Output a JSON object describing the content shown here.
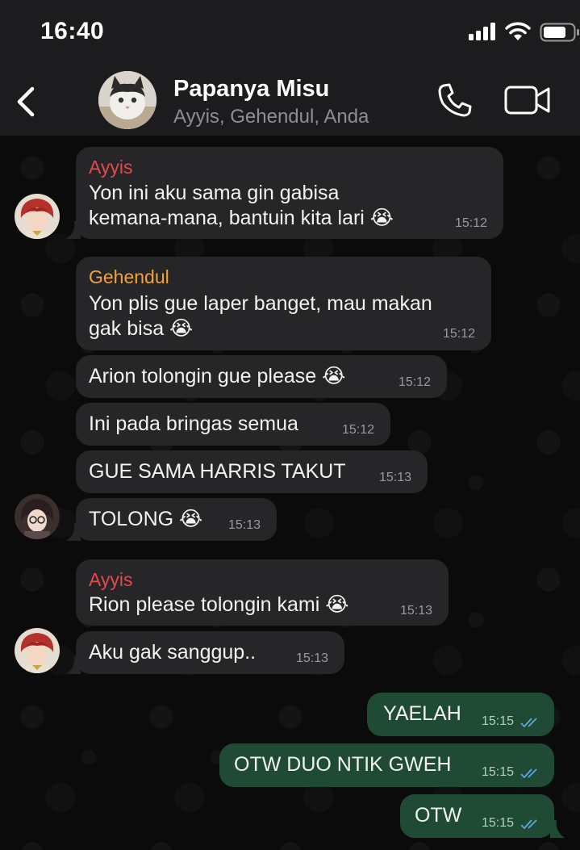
{
  "status_bar": {
    "time": "16:40"
  },
  "header": {
    "back_icon": "chevron-left-icon",
    "title": "Papanya Misu",
    "subtitle": "Ayyis, Gehendul, Anda",
    "call_icon": "phone-icon",
    "video_icon": "video-camera-icon"
  },
  "colors": {
    "incoming_bubble": "#262628",
    "outgoing_bubble": "#1f4a33",
    "sender_ayyis": "#e5484d",
    "sender_gehendul": "#f4a13a",
    "read_ticks": "#5aa9e6"
  },
  "messages": [
    {
      "sender": "Ayyis",
      "line1": "Yon ini aku sama gin gabisa",
      "line2": "kemana-mana, bantuin kita lari 😭",
      "time": "15:12"
    },
    {
      "sender": "Gehendul",
      "line1": "Yon plis gue laper banget, mau makan",
      "line2": "gak bisa 😭",
      "time": "15:12"
    },
    {
      "text": "Arion tolongin gue please 😭",
      "time": "15:12"
    },
    {
      "text": "Ini pada bringas semua",
      "time": "15:12"
    },
    {
      "text": "GUE SAMA HARRIS TAKUT",
      "time": "15:13"
    },
    {
      "text": "TOLONG 😭",
      "time": "15:13"
    },
    {
      "sender": "Ayyis",
      "text": "Rion please tolongin kami 😭",
      "time": "15:13"
    },
    {
      "text": "Aku gak sanggup..",
      "time": "15:13"
    },
    {
      "text": "YAELAH",
      "time": "15:15",
      "status": "read"
    },
    {
      "text": "OTW DUO NTIK GWEH",
      "time": "15:15",
      "status": "read"
    },
    {
      "text": "OTW",
      "time": "15:15",
      "status": "read"
    }
  ]
}
